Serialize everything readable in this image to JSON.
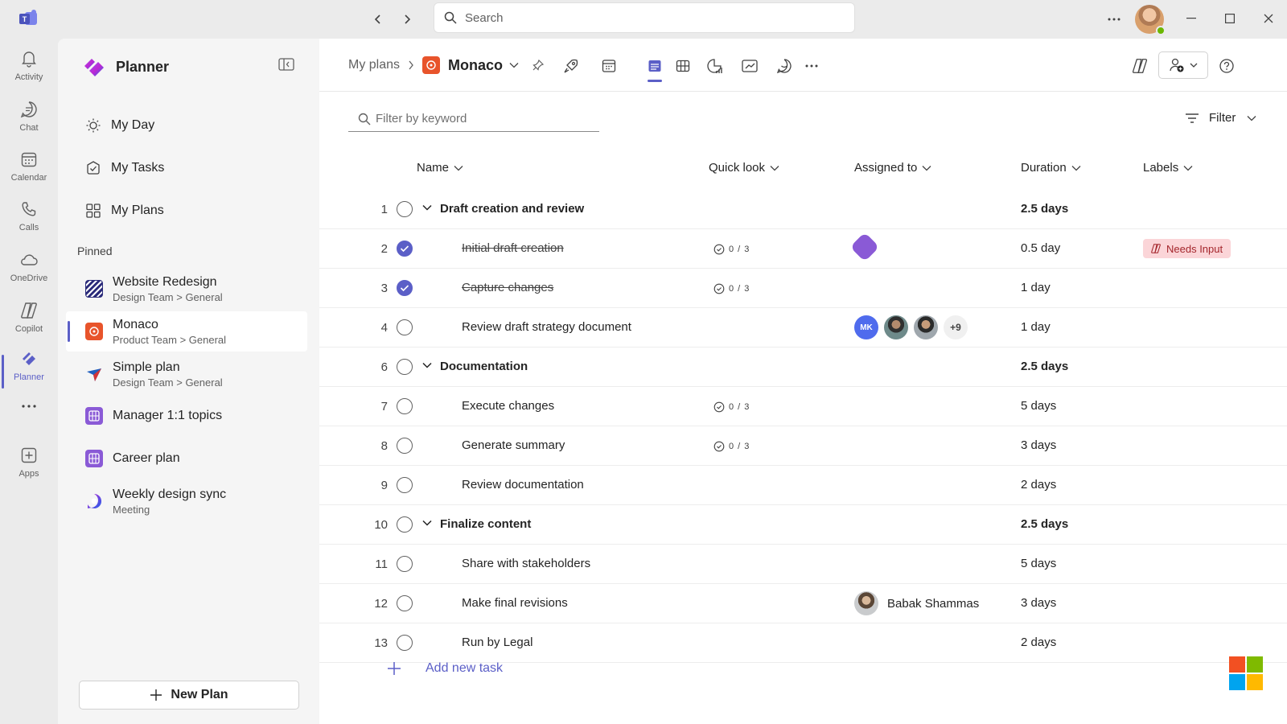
{
  "titlebar": {
    "search_placeholder": "Search"
  },
  "rail": [
    {
      "label": "Activity",
      "icon": "bell-icon"
    },
    {
      "label": "Chat",
      "icon": "chat-icon"
    },
    {
      "label": "Calendar",
      "icon": "calendar-icon"
    },
    {
      "label": "Calls",
      "icon": "phone-icon"
    },
    {
      "label": "OneDrive",
      "icon": "cloud-icon"
    },
    {
      "label": "Copilot",
      "icon": "copilot-icon"
    },
    {
      "label": "Planner",
      "icon": "planner-icon"
    },
    {
      "label": "Apps",
      "icon": "add-app-icon"
    }
  ],
  "sidebar": {
    "app_title": "Planner",
    "nav": [
      {
        "label": "My Day",
        "icon": "sun-icon"
      },
      {
        "label": "My Tasks",
        "icon": "task-icon"
      },
      {
        "label": "My Plans",
        "icon": "grid-icon"
      }
    ],
    "pinned_label": "Pinned",
    "plans": [
      {
        "title": "Website Redesign",
        "sub": "Design Team > General"
      },
      {
        "title": "Monaco",
        "sub": "Product Team > General"
      },
      {
        "title": "Simple plan",
        "sub": "Design Team > General"
      },
      {
        "title": "Manager 1:1 topics",
        "sub": ""
      },
      {
        "title": "Career plan",
        "sub": ""
      },
      {
        "title": "Weekly design sync",
        "sub": "Meeting"
      }
    ],
    "new_plan": "New Plan"
  },
  "header": {
    "breadcrumb_root": "My plans",
    "plan_name": "Monaco"
  },
  "toolbar": {
    "filter_placeholder": "Filter by keyword",
    "filter_label": "Filter"
  },
  "columns": {
    "name": "Name",
    "quick_look": "Quick look",
    "assigned_to": "Assigned to",
    "duration": "Duration",
    "labels": "Labels"
  },
  "rows": [
    {
      "num": "1",
      "name": "Draft creation and review",
      "duration": "2.5 days"
    },
    {
      "num": "2",
      "name": "Initial draft creation",
      "quick": "0 / 3",
      "duration": "0.5 day",
      "label": "Needs Input"
    },
    {
      "num": "3",
      "name": "Capture changes",
      "quick": "0 / 3",
      "duration": "1 day"
    },
    {
      "num": "4",
      "name": "Review draft strategy document",
      "duration": "1 day",
      "assignee_initials": "MK",
      "assignee_more": "+9"
    },
    {
      "num": "6",
      "name": "Documentation",
      "duration": "2.5 days"
    },
    {
      "num": "7",
      "name": "Execute changes",
      "quick": "0 / 3",
      "duration": "5 days"
    },
    {
      "num": "8",
      "name": "Generate summary",
      "quick": "0 / 3",
      "duration": "3 days"
    },
    {
      "num": "9",
      "name": "Review documentation",
      "duration": "2 days"
    },
    {
      "num": "10",
      "name": "Finalize content",
      "duration": "2.5 days"
    },
    {
      "num": "11",
      "name": "Share with stakeholders",
      "duration": "5 days"
    },
    {
      "num": "12",
      "name": "Make final revisions",
      "duration": "3 days",
      "assignee_name": "Babak Shammas"
    },
    {
      "num": "13",
      "name": "Run by Legal",
      "duration": "2 days"
    }
  ],
  "add_task": "Add new task",
  "colors": {
    "accent": "#5b5fc7",
    "label_bg": "#fbd5d8",
    "label_fg": "#a4262c"
  }
}
